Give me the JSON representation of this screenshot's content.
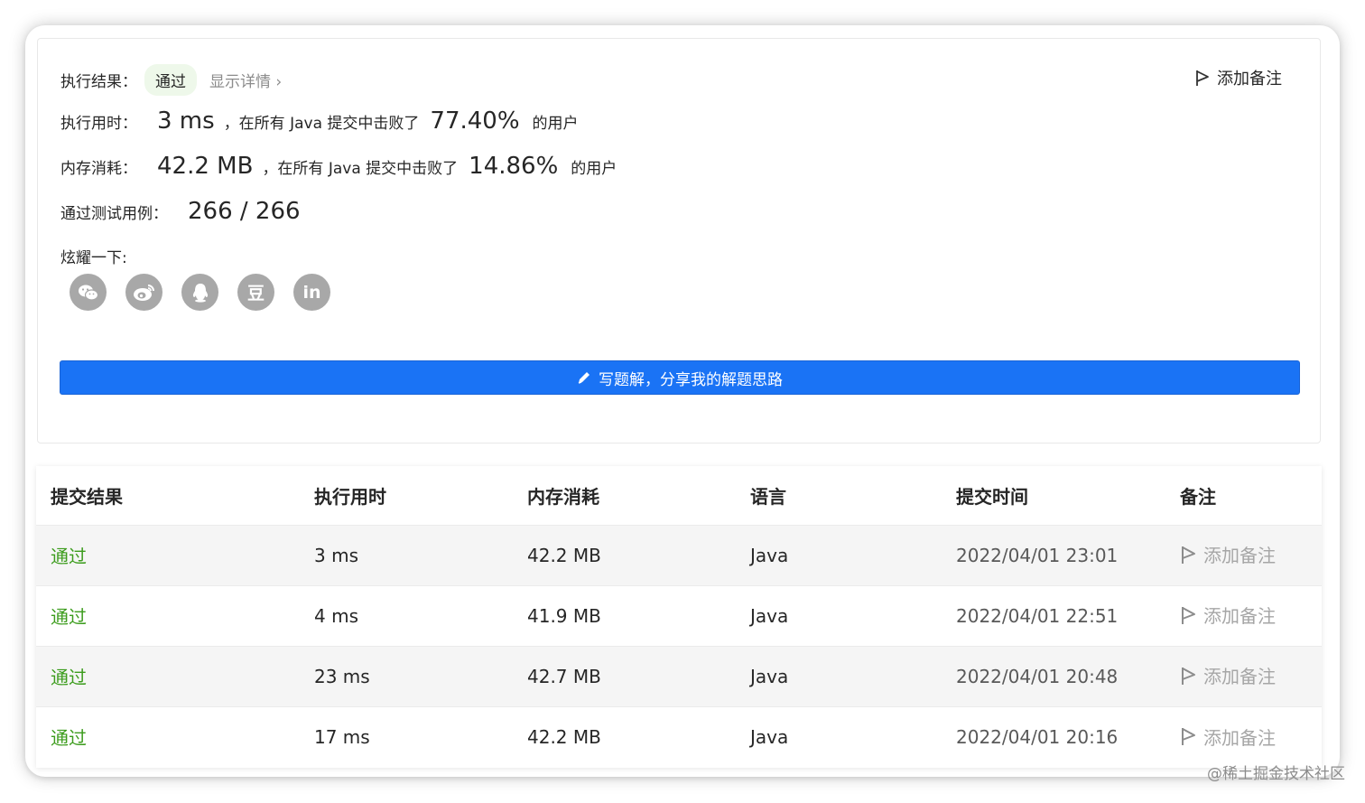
{
  "result": {
    "label": "执行结果：",
    "status": "通过",
    "details_link": "显示详情 ›",
    "add_note": "添加备注"
  },
  "runtime": {
    "label": "执行用时：",
    "value": "3 ms",
    "mid_text": "，在所有 Java 提交中击败了",
    "percent": "77.40%",
    "suffix": "的用户"
  },
  "memory": {
    "label": "内存消耗：",
    "value": "42.2 MB",
    "mid_text": "，在所有 Java 提交中击败了",
    "percent": "14.86%",
    "suffix": "的用户"
  },
  "testcases": {
    "label": "通过测试用例：",
    "value": "266 / 266"
  },
  "share": {
    "label": "炫耀一下:",
    "icons": [
      "wechat-icon",
      "weibo-icon",
      "qq-icon",
      "douban-icon",
      "linkedin-icon"
    ],
    "douban_glyph": "豆",
    "linkedin_glyph": "in"
  },
  "write_solution": "写题解，分享我的解题思路",
  "table": {
    "headers": [
      "提交结果",
      "执行用时",
      "内存消耗",
      "语言",
      "提交时间",
      "备注"
    ],
    "rows": [
      {
        "status": "通过",
        "runtime": "3 ms",
        "memory": "42.2 MB",
        "lang": "Java",
        "time": "2022/04/01 23:01",
        "note": "添加备注"
      },
      {
        "status": "通过",
        "runtime": "4 ms",
        "memory": "41.9 MB",
        "lang": "Java",
        "time": "2022/04/01 22:51",
        "note": "添加备注"
      },
      {
        "status": "通过",
        "runtime": "23 ms",
        "memory": "42.7 MB",
        "lang": "Java",
        "time": "2022/04/01 20:48",
        "note": "添加备注"
      },
      {
        "status": "通过",
        "runtime": "17 ms",
        "memory": "42.2 MB",
        "lang": "Java",
        "time": "2022/04/01 20:16",
        "note": "添加备注"
      }
    ]
  },
  "watermark": "@稀土掘金技术社区",
  "colors": {
    "accent": "#1a73f5",
    "pass_green": "#3c9c1d",
    "badge_bg": "#eef8ea"
  }
}
